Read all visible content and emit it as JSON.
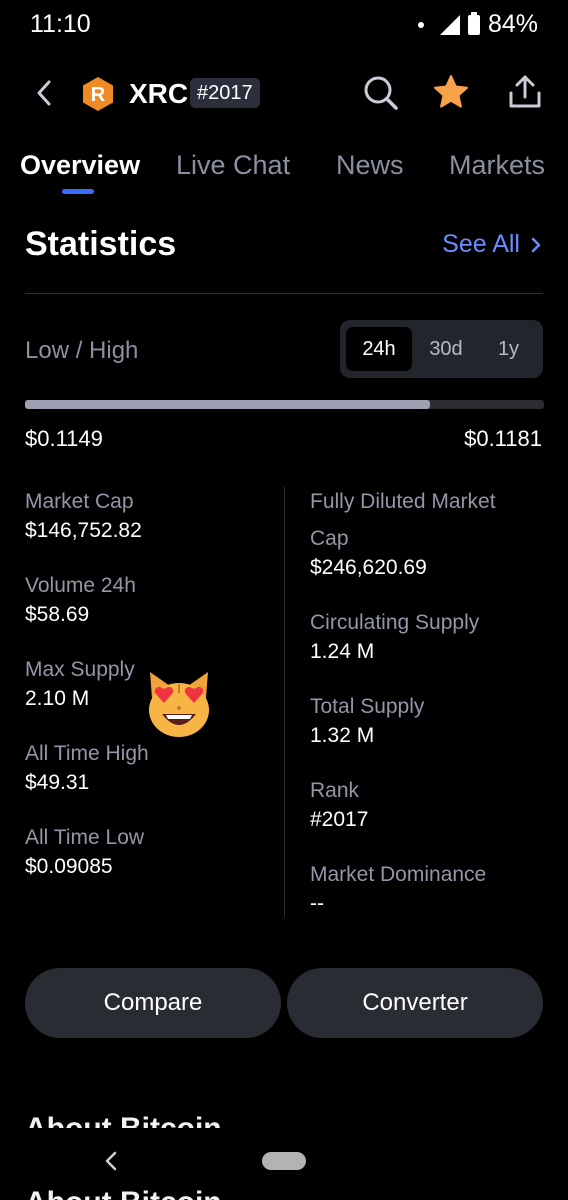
{
  "status_bar": {
    "time": "11:10",
    "battery": "84%"
  },
  "header": {
    "coin_symbol": "XRC",
    "coin_logo_letter": "R",
    "rank_badge": "#2017"
  },
  "tabs": [
    {
      "label": "Overview",
      "active": true
    },
    {
      "label": "Live Chat",
      "active": false
    },
    {
      "label": "News",
      "active": false
    },
    {
      "label": "Markets",
      "active": false
    }
  ],
  "statistics": {
    "title": "Statistics",
    "see_all": "See All",
    "low_high_label": "Low / High",
    "periods": [
      {
        "label": "24h",
        "active": true
      },
      {
        "label": "30d",
        "active": false
      },
      {
        "label": "1y",
        "active": false
      }
    ],
    "range": {
      "low": "$0.1149",
      "high": "$0.1181",
      "fill_fraction": 0.78
    },
    "left_column": [
      {
        "label": "Market Cap",
        "value": "$146,752.82"
      },
      {
        "label": "Volume 24h",
        "value": "$58.69"
      },
      {
        "label": "Max Supply",
        "value": "2.10 M"
      },
      {
        "label": "All Time High",
        "value": "$49.31"
      },
      {
        "label": "All Time Low",
        "value": "$0.09085"
      }
    ],
    "right_column": [
      {
        "label_line1": "Fully Diluted Market",
        "label_line2": "Cap",
        "value": "$246,620.69"
      },
      {
        "label": "Circulating Supply",
        "value": "1.24 M"
      },
      {
        "label": "Total Supply",
        "value": "1.32 M"
      },
      {
        "label": "Rank",
        "value": "#2017"
      },
      {
        "label": "Market Dominance",
        "value": "--"
      }
    ]
  },
  "actions": {
    "compare": "Compare",
    "converter": "Converter"
  },
  "below_fold": {
    "heading": "About Bitcoin"
  },
  "colors": {
    "accent": "#3b6bff",
    "link": "#6b8cff",
    "star": "#f7a24a",
    "coin": "#f08a24"
  },
  "icons": [
    "back-icon",
    "search-icon",
    "star-icon",
    "share-icon",
    "chevron-right-icon",
    "cat-heart-eyes-emoji"
  ]
}
